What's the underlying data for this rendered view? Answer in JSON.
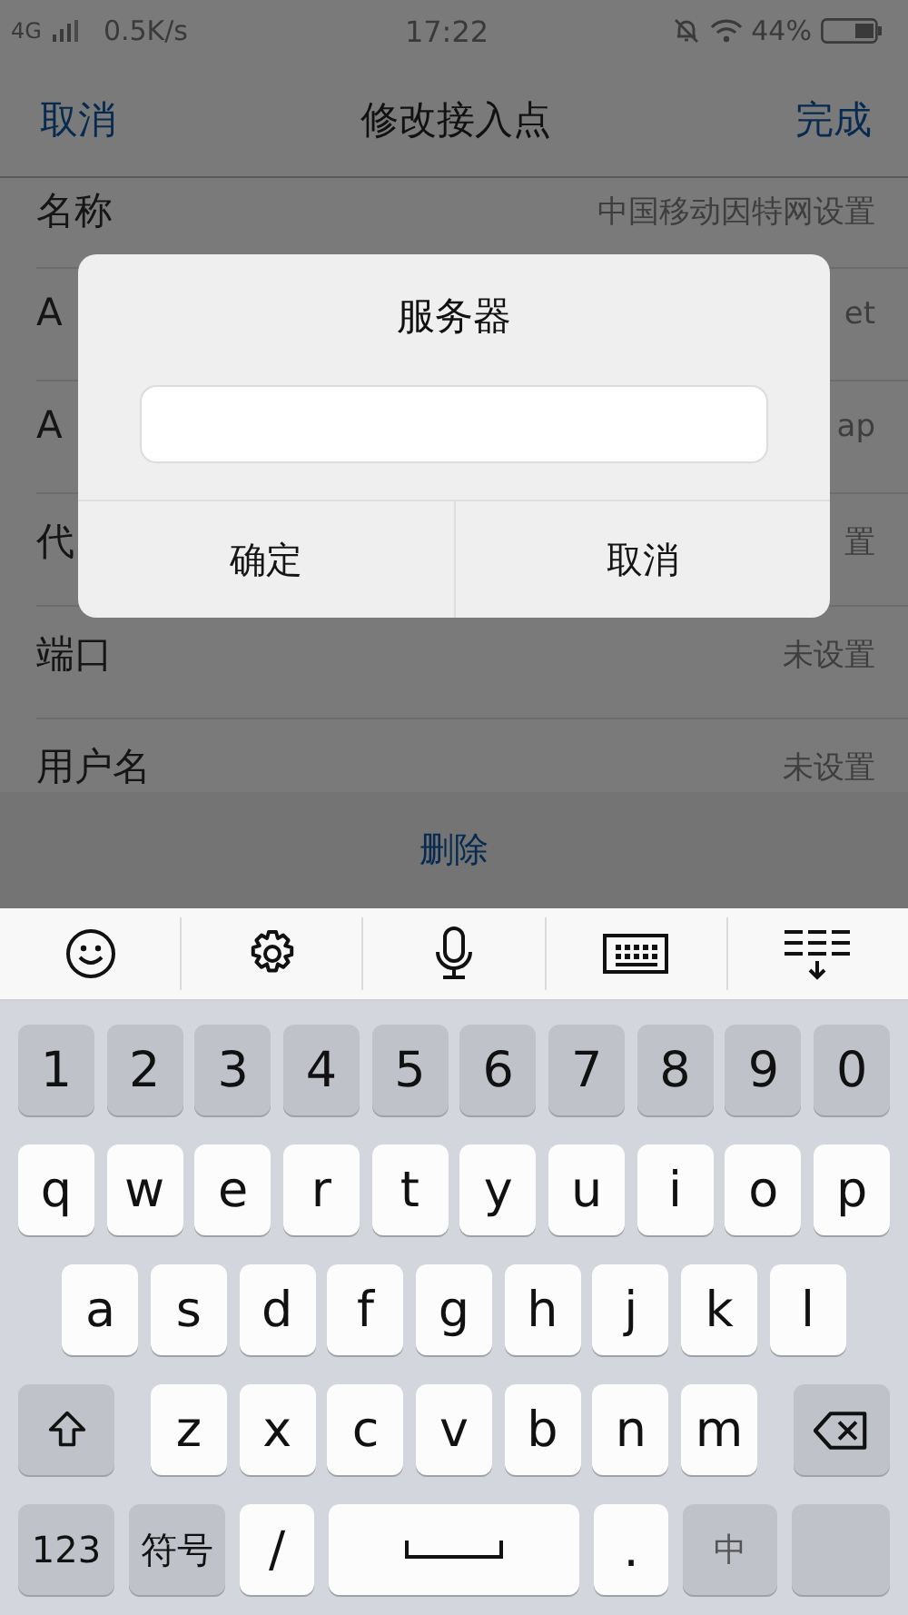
{
  "status_bar": {
    "network": "4G",
    "speed": "0.5K/s",
    "time": "17:22",
    "battery": "44%"
  },
  "nav_bar": {
    "cancel": "取消",
    "title": "修改接入点",
    "done": "完成"
  },
  "rows": [
    {
      "label": "名称",
      "value": "中国移动因特网设置"
    },
    {
      "label": "A",
      "value": "et"
    },
    {
      "label": "A",
      "value": "ap"
    },
    {
      "label": "代",
      "value": "置"
    },
    {
      "label": "端口",
      "value": "未设置"
    },
    {
      "label": "用户名",
      "value": "未设置"
    }
  ],
  "delete_button": "删除",
  "dialog": {
    "title": "服务器",
    "buttons": [
      "确定",
      "取消"
    ]
  },
  "keyboard": {
    "rows": [
      {
        "keys": [
          {
            "kind": "number",
            "label": "1"
          },
          {
            "kind": "number",
            "label": "2"
          },
          {
            "kind": "number",
            "label": "3"
          },
          {
            "kind": "number",
            "label": "4"
          },
          {
            "kind": "number",
            "label": "5"
          },
          {
            "kind": "number",
            "label": "6"
          },
          {
            "kind": "number",
            "label": "7"
          },
          {
            "kind": "number",
            "label": "8"
          },
          {
            "kind": "number",
            "label": "9"
          },
          {
            "kind": "number",
            "label": "0"
          }
        ]
      },
      {
        "keys": [
          {
            "kind": "letter",
            "label": "q"
          },
          {
            "kind": "letter",
            "label": "w"
          },
          {
            "kind": "letter",
            "label": "e"
          },
          {
            "kind": "letter",
            "label": "r"
          },
          {
            "kind": "letter",
            "label": "t"
          },
          {
            "kind": "letter",
            "label": "y"
          },
          {
            "kind": "letter",
            "label": "u"
          },
          {
            "kind": "letter",
            "label": "i"
          },
          {
            "kind": "letter",
            "label": "o"
          },
          {
            "kind": "letter",
            "label": "p"
          }
        ]
      },
      {
        "keys": [
          {
            "kind": "letter",
            "label": "a"
          },
          {
            "kind": "letter",
            "label": "s"
          },
          {
            "kind": "letter",
            "label": "d"
          },
          {
            "kind": "letter",
            "label": "f"
          },
          {
            "kind": "letter",
            "label": "g"
          },
          {
            "kind": "letter",
            "label": "h"
          },
          {
            "kind": "letter",
            "label": "j"
          },
          {
            "kind": "letter",
            "label": "k"
          },
          {
            "kind": "letter",
            "label": "l"
          }
        ]
      },
      {
        "keys": [
          {
            "kind": "shift"
          },
          {
            "kind": "letter",
            "label": "z"
          },
          {
            "kind": "letter",
            "label": "x"
          },
          {
            "kind": "letter",
            "label": "c"
          },
          {
            "kind": "letter",
            "label": "v"
          },
          {
            "kind": "letter",
            "label": "b"
          },
          {
            "kind": "letter",
            "label": "n"
          },
          {
            "kind": "letter",
            "label": "m"
          },
          {
            "kind": "delete"
          }
        ]
      },
      {
        "keys": [
          {
            "kind": "function",
            "label": "123"
          },
          {
            "kind": "function",
            "label": "符号"
          },
          {
            "kind": "symbol",
            "label": "/"
          },
          {
            "kind": "space"
          },
          {
            "kind": "symbol",
            "label": "."
          },
          {
            "kind": "language",
            "label": "中"
          },
          {
            "kind": "enter"
          }
        ]
      }
    ]
  }
}
